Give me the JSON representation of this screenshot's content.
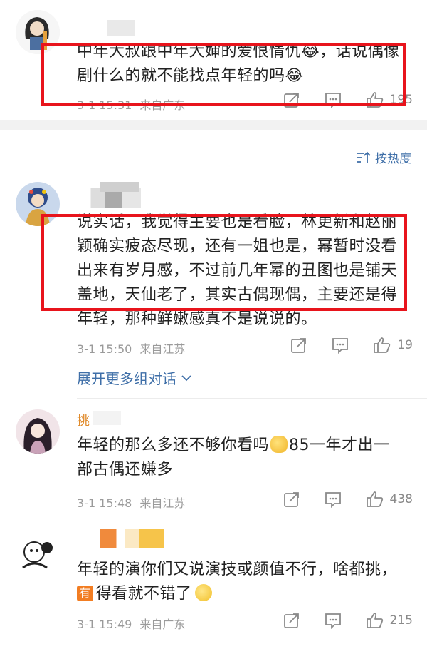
{
  "sort": {
    "label": "按热度"
  },
  "comments": [
    {
      "text": "中年大叔跟中年大婶的爱恨情仇😂，话说偶像剧什么的就不能找点年轻的吗😂",
      "time": "3-1 15:31",
      "location": "来自广东",
      "likes": "195"
    },
    {
      "text": "说实话，我觉得主要也是看脸，林更新和赵丽颖确实疲态尽现，还有一姐也是，幂暂时没看出来有岁月感，不过前几年幂的丑图也是铺天盖地，天仙老了，其实古偶现偶，主要还是得年轻，那种鲜嫩感真不是说说的。",
      "time": "3-1 15:50",
      "location": "来自江苏",
      "likes": "19",
      "expand": "展开更多组对话"
    },
    {
      "username_partial": "挑",
      "text_line1": "年轻的那么多还不够你看吗",
      "text_line1b": "85一年才出一",
      "text_line2": "部古偶还嫌多",
      "time": "3-1 15:48",
      "location": "来自江苏",
      "likes": "438"
    },
    {
      "text_line1": "年轻的演你们又说演技或颜值不行，啥都挑，",
      "badge": "有",
      "text_line2": "得看就不错了",
      "time": "3-1 15:49",
      "location": "来自广东",
      "likes": "215"
    }
  ],
  "colors": {
    "accent_link": "#3f6fa8",
    "red_box": "#e8141c",
    "meta": "#9a9a9a"
  }
}
